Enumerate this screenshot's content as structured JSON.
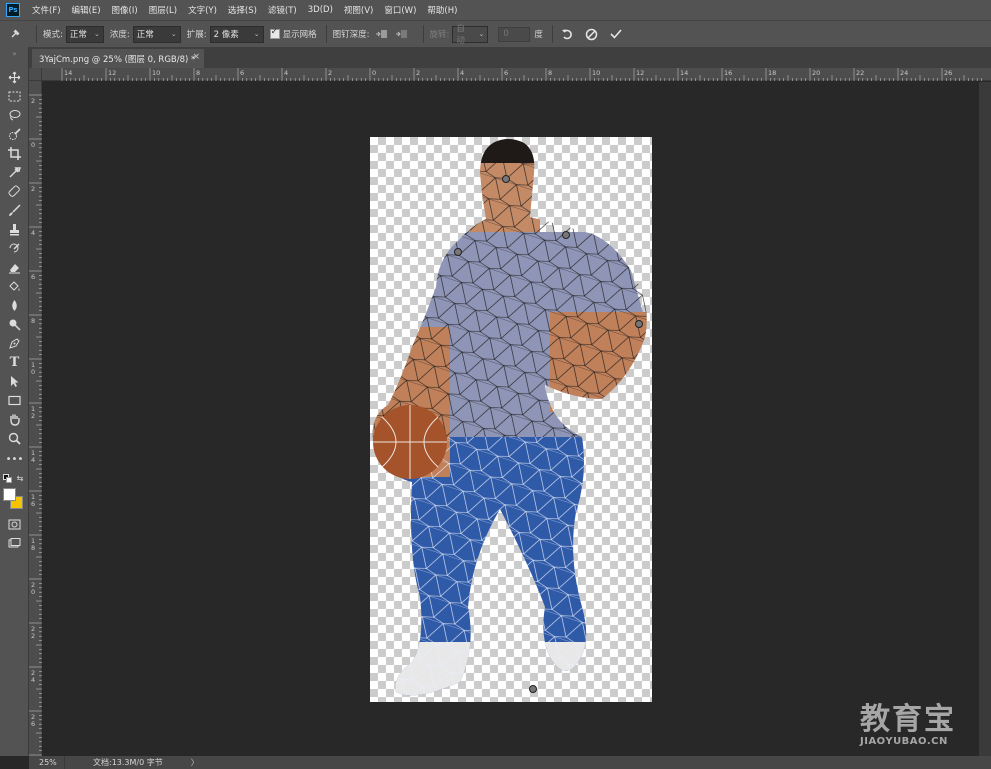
{
  "app": {
    "logo": "Ps"
  },
  "menu": [
    "文件(F)",
    "编辑(E)",
    "图像(I)",
    "图层(L)",
    "文字(Y)",
    "选择(S)",
    "滤镜(T)",
    "3D(D)",
    "视图(V)",
    "窗口(W)",
    "帮助(H)"
  ],
  "options": {
    "mode_label": "模式:",
    "mode_value": "正常",
    "density_label": "浓度:",
    "density_value": "正常",
    "expansion_label": "扩展:",
    "expansion_value": "2 像素",
    "show_mesh_label": "显示网格",
    "show_mesh_checked": true,
    "pin_depth_label": "图钉深度:",
    "rotate_label": "旋转:",
    "rotate_value": "自动",
    "angle_placeholder": "0",
    "degree_label": "度"
  },
  "document_tab": {
    "title": "3YajCm.png @ 25% (图层 0, RGB/8) *",
    "close": "×"
  },
  "rulers": {
    "top": [
      "14",
      "12",
      "10",
      "8",
      "6",
      "4",
      "2",
      "0",
      "2",
      "4",
      "6",
      "8",
      "10",
      "12",
      "14",
      "16",
      "18",
      "20",
      "22",
      "24",
      "26"
    ],
    "left": [
      "2",
      "0",
      "2",
      "4",
      "6",
      "8",
      "1\n0",
      "1\n2",
      "1\n4",
      "1\n6",
      "1\n8",
      "2\n0",
      "2\n2",
      "2\n4",
      "2\n6",
      "2\n8"
    ]
  },
  "status": {
    "zoom": "25%",
    "doc_info": "文档:13.3M/0 字节",
    "arrow": "〉"
  },
  "watermark": {
    "main": "教育宝",
    "sub": "JIAOYUBAO.CN"
  },
  "colors": {
    "foreground": "#ffffff",
    "background": "#f5c400"
  }
}
